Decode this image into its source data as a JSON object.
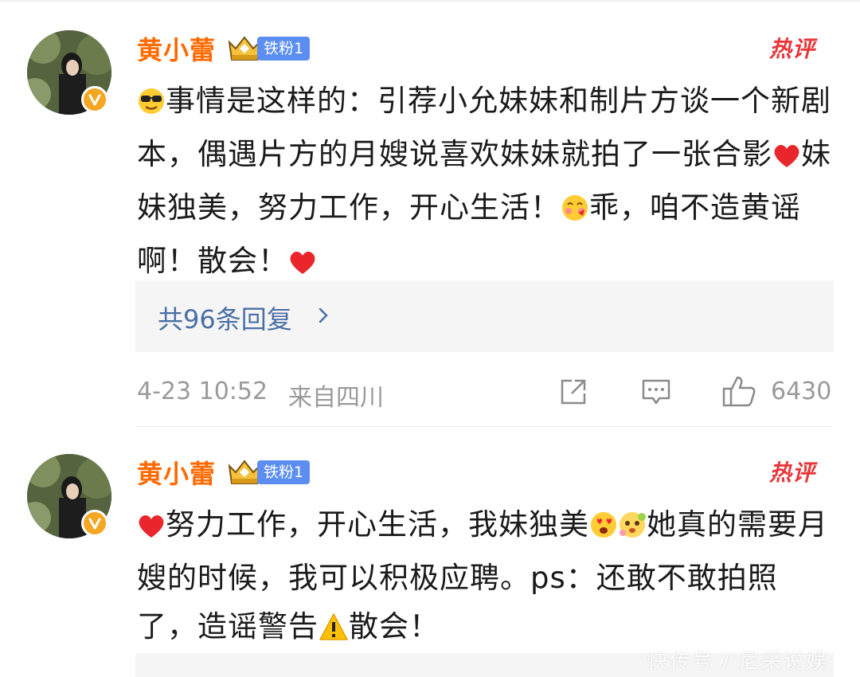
{
  "comments": [
    {
      "username": "黄小蕾",
      "fan_badge": "铁粉1",
      "hot_tag": "热评",
      "text_parts": {
        "p1": "事情是这样的：引荐小允妹妹和制片方谈一个新剧本，偶遇片方的月嫂说喜欢妹妹就拍了一张合影",
        "p2": "妹妹独美，努力工作，开心生活！",
        "p3": "乖，咱不造黄谣啊！散会！"
      },
      "reply_link": "共96条回复",
      "timestamp": "4-23 10:52",
      "source": "来自四川",
      "like_count": "6430"
    },
    {
      "username": "黄小蕾",
      "fan_badge": "铁粉1",
      "hot_tag": "热评",
      "text_parts": {
        "p1": "努力工作，开心生活，我妹独美",
        "p2": "她真的需要月嫂的时候，我可以积极应聘。ps：还敢不敢拍照了，造谣警告",
        "p3": "散会！"
      }
    }
  ],
  "watermark": "快传号 / 尼采说娱",
  "icons": {
    "avatar": "avatar-photo",
    "verified": "verified-v-icon",
    "crown": "crown-icon",
    "share": "share-icon",
    "comment": "comment-icon",
    "like": "thumbs-up-icon",
    "chevron": "chevron-right-icon"
  },
  "colors": {
    "username": "#ff6a00",
    "hot": "#e8363a",
    "badge": "#5b8ef0",
    "link": "#4a6fa5",
    "meta": "#9a9a9a",
    "verified": "#f5a623"
  }
}
